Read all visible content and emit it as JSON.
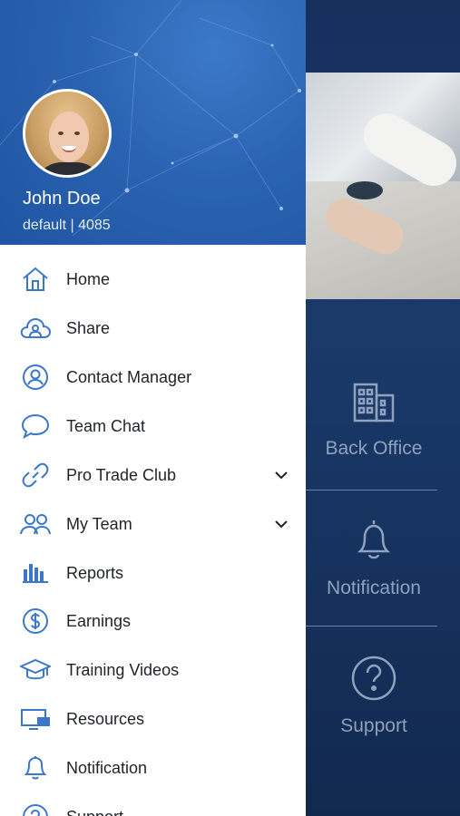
{
  "colors": {
    "accent": "#2a63b1",
    "icon": "#3b78c9",
    "background_panel": "#16305c"
  },
  "user": {
    "name": "John Doe",
    "subtitle": "default | 4085"
  },
  "menu": [
    {
      "label": "Home",
      "icon": "home-icon"
    },
    {
      "label": "Share",
      "icon": "cloud-share-icon"
    },
    {
      "label": "Contact Manager",
      "icon": "contact-icon"
    },
    {
      "label": "Team Chat",
      "icon": "chat-bubble-icon"
    },
    {
      "label": "Pro Trade Club",
      "icon": "link-icon",
      "expandable": true
    },
    {
      "label": "My Team",
      "icon": "team-icon",
      "expandable": true
    },
    {
      "label": "Reports",
      "icon": "bar-chart-icon"
    },
    {
      "label": "Earnings",
      "icon": "dollar-icon"
    },
    {
      "label": "Training Videos",
      "icon": "graduation-cap-icon"
    },
    {
      "label": "Resources",
      "icon": "monitor-icon"
    },
    {
      "label": "Notification",
      "icon": "bell-icon"
    },
    {
      "label": "Support",
      "icon": "help-icon"
    }
  ],
  "background_menu": [
    {
      "label": "Back Office",
      "icon": "building-icon"
    },
    {
      "label": "Notification",
      "icon": "bell-icon"
    },
    {
      "label": "Support",
      "icon": "help-icon"
    }
  ]
}
